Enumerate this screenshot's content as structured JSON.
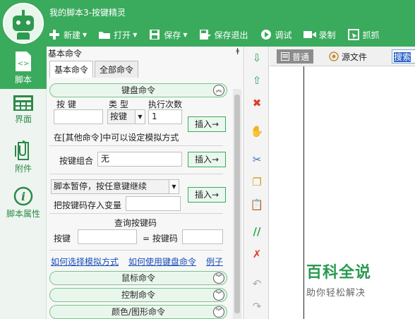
{
  "window": {
    "title": "我的脚本3-按键精灵"
  },
  "toolbar": [
    {
      "label": "新建",
      "icon": "plus-icon",
      "dropdown": true
    },
    {
      "label": "打开",
      "icon": "folder-icon",
      "dropdown": true
    },
    {
      "label": "保存",
      "icon": "save-icon",
      "dropdown": true
    },
    {
      "label": "保存退出",
      "icon": "save-exit-icon",
      "dropdown": false
    },
    {
      "label": "调试",
      "icon": "play-icon",
      "dropdown": false
    },
    {
      "label": "录制",
      "icon": "record-icon",
      "dropdown": false
    },
    {
      "label": "抓抓",
      "icon": "capture-icon",
      "dropdown": false
    }
  ],
  "leftnav": [
    {
      "label": "脚本",
      "icon": "script-icon",
      "active": true
    },
    {
      "label": "界面",
      "icon": "interface-icon",
      "active": false
    },
    {
      "label": "附件",
      "icon": "attachment-icon",
      "active": false
    },
    {
      "label": "脚本属性",
      "icon": "info-icon",
      "active": false
    }
  ],
  "panel": {
    "title": "基本命令",
    "pin": "ǂ",
    "tabs": [
      "基本命令",
      "全部命令"
    ],
    "keyboard_section": "键盘命令",
    "key_label": "按 键",
    "type_label": "类 型",
    "times_label": "执行次数",
    "key_value": "",
    "type_value": "按键",
    "times_value": "1",
    "insert_label": "插入→",
    "mode_note": "在[其他命令]中可以设定模拟方式",
    "combo_label": "按键组合",
    "combo_value": "无",
    "pause_select": "脚本暂停，按任意键继续",
    "store_label": "把按键码存入变量",
    "store_value": "",
    "query_title": "查询按键码",
    "query_key_label": "按键",
    "query_key_value": "",
    "query_code_label": "= 按键码",
    "query_code_value": "",
    "links": [
      "如何选择模拟方式",
      "如何使用键盘命令",
      "例子"
    ],
    "sections": [
      "鼠标命令",
      "控制命令",
      "颜色/图形命令"
    ]
  },
  "editor": {
    "tabs": [
      "普通",
      "源文件"
    ],
    "search_text": "搜索"
  },
  "watermark": {
    "title": "百科全说",
    "subtitle": "助你轻松解决"
  },
  "colors": {
    "brand_green": "#3aaa5c",
    "link_blue": "#1a4fb8"
  }
}
